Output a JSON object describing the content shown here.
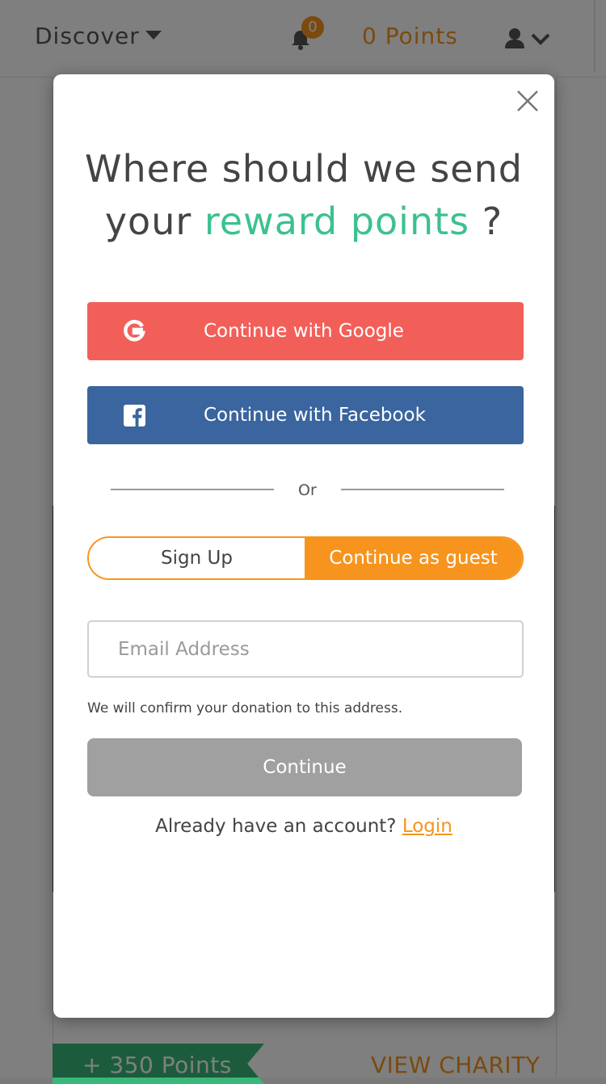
{
  "topbar": {
    "discover_label": "Discover",
    "notification_count": "0",
    "points_label": "0 Points"
  },
  "background_card": {
    "points_badge": "+ 350 Points",
    "view_charity_label": "VIEW CHARITY"
  },
  "modal": {
    "title_line1": "Where should we send",
    "title_line2_prefix": "your",
    "title_accent": "reward points",
    "title_suffix": "?",
    "google_label": "Continue with Google",
    "facebook_label": "Continue with Facebook",
    "or_label": "Or",
    "toggle": {
      "signup_label": "Sign Up",
      "guest_label": "Continue as guest",
      "selected": "guest"
    },
    "email": {
      "placeholder": "Email Address",
      "value": ""
    },
    "hint": "We will confirm your donation to this address.",
    "continue_label": "Continue",
    "login_prompt": "Already have an account?",
    "login_link": "Login"
  },
  "colors": {
    "accent_green": "#3cc18e",
    "accent_orange": "#f7941d",
    "google_red": "#f25f59",
    "facebook_blue": "#3a659e",
    "disabled_gray": "#a0a0a0"
  },
  "icons": [
    "chevron-down-icon",
    "bell-icon",
    "user-icon",
    "close-icon",
    "google-icon",
    "facebook-icon"
  ]
}
